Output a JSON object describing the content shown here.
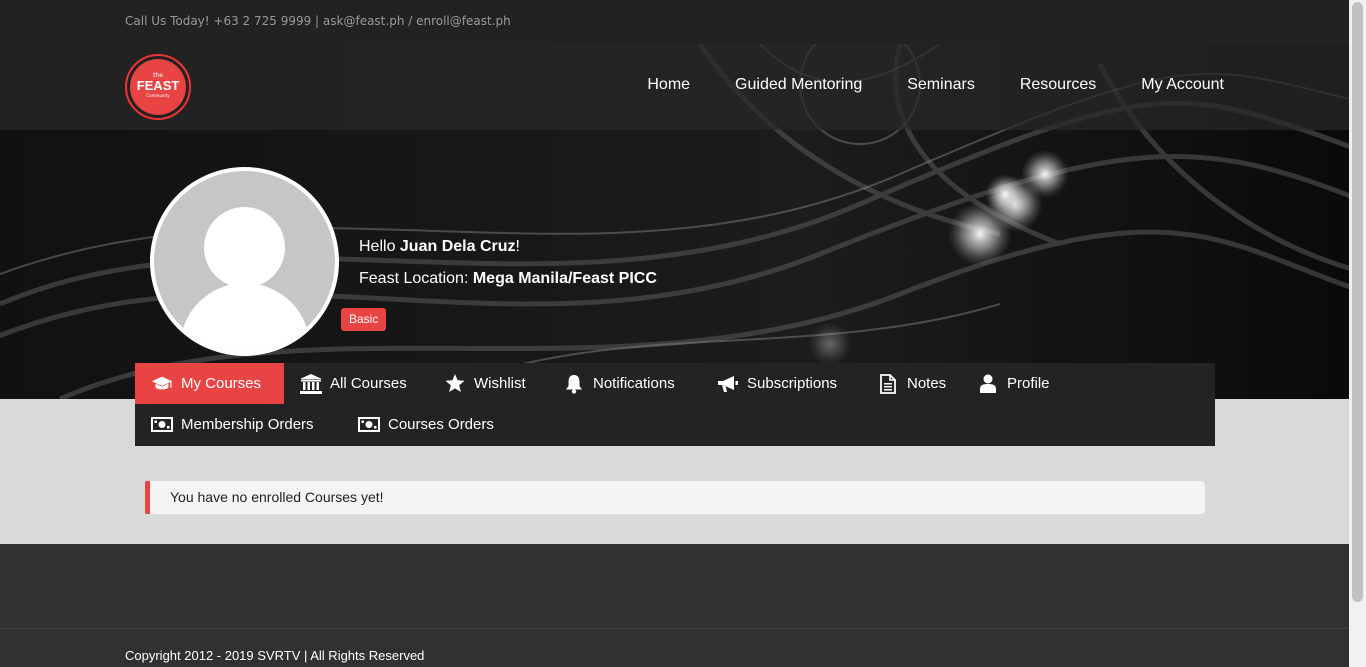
{
  "topbar": {
    "contact": "Call Us Today! +63 2 725 9999  |  ask@feast.ph / enroll@feast.ph"
  },
  "logo": {
    "the": "the",
    "name": "FEAST",
    "sub": "Community"
  },
  "nav": {
    "items": [
      {
        "label": "Home"
      },
      {
        "label": "Guided Mentoring"
      },
      {
        "label": "Seminars"
      },
      {
        "label": "Resources"
      },
      {
        "label": "My Account"
      }
    ]
  },
  "profile": {
    "greeting": "Hello ",
    "name": "Juan Dela Cruz",
    "greeting_suffix": "!",
    "location_label": "Feast Location: ",
    "location": "Mega Manila/Feast PICC",
    "membership_badge": "Basic"
  },
  "tabs": [
    {
      "label": "My Courses",
      "icon": "graduation-cap-icon",
      "active": true
    },
    {
      "label": "All Courses",
      "icon": "institution-icon",
      "active": false
    },
    {
      "label": "Wishlist",
      "icon": "star-icon",
      "active": false
    },
    {
      "label": "Notifications",
      "icon": "bell-icon",
      "active": false
    },
    {
      "label": "Subscriptions",
      "icon": "bullhorn-icon",
      "active": false
    },
    {
      "label": "Notes",
      "icon": "document-icon",
      "active": false
    },
    {
      "label": "Profile",
      "icon": "user-icon",
      "active": false
    },
    {
      "label": "Membership Orders",
      "icon": "money-icon",
      "active": false
    },
    {
      "label": "Courses Orders",
      "icon": "money-icon",
      "active": false
    }
  ],
  "alert": {
    "message": "You have no enrolled Courses yet!"
  },
  "footer": {
    "copyright": "Copyright 2012 - 2019 SVRTV | All Rights Reserved"
  },
  "colors": {
    "accent": "#e84444",
    "topbar": "#222222",
    "tabs_bg": "#232323",
    "footer": "#313131"
  }
}
